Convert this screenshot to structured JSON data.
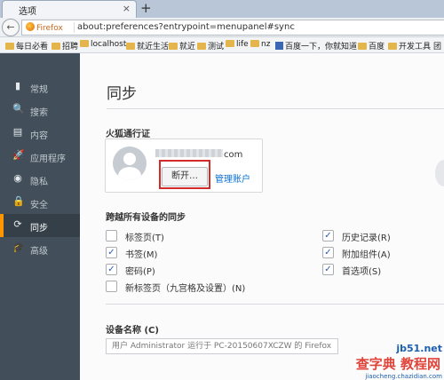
{
  "tab": {
    "title": "选项",
    "close": "×",
    "new_tab": "+"
  },
  "navbar": {
    "back": "←",
    "identity": "Firefox",
    "url": "about:preferences?entrypoint=menupanel#sync"
  },
  "bookmarks": [
    "每日必看",
    "招聘",
    "localhost",
    "就近生活",
    "就近",
    "测试",
    "life",
    "nz",
    "百度一下，你就知道",
    "百度",
    "开发工具",
    "团"
  ],
  "sidebar": {
    "items": [
      {
        "label": "常规",
        "icon": "▮"
      },
      {
        "label": "搜索",
        "icon": "🔍"
      },
      {
        "label": "内容",
        "icon": "▤"
      },
      {
        "label": "应用程序",
        "icon": "🚀"
      },
      {
        "label": "隐私",
        "icon": "◉"
      },
      {
        "label": "安全",
        "icon": "🔒"
      },
      {
        "label": "同步",
        "icon": "⟳"
      },
      {
        "label": "高级",
        "icon": "🎓"
      }
    ],
    "selected_index": 6,
    "accent": "#ff9500"
  },
  "main": {
    "title": "同步",
    "account_section": "火狐通行证",
    "email_suffix": "com",
    "disconnect": "断开…",
    "manage_account": "管理账户",
    "sync_section": "跨越所有设备的同步",
    "options_left": [
      {
        "label": "标签页(T)",
        "checked": false
      },
      {
        "label": "书签(M)",
        "checked": true
      },
      {
        "label": "密码(P)",
        "checked": true
      },
      {
        "label": "新标签页（九宫格及设置）(N)",
        "checked": false
      }
    ],
    "options_right": [
      {
        "label": "历史记录(R)",
        "checked": true
      },
      {
        "label": "附加组件(A)",
        "checked": true
      },
      {
        "label": "首选项(S)",
        "checked": true
      }
    ],
    "device_section": "设备名称 (C)",
    "device_name": "用户 Administrator 运行于 PC-20150607XCZW 的 Firefox"
  },
  "watermark": {
    "line1": "jb51.net",
    "line2": "查字典 教程网",
    "line3": "jiaocheng.chazidian.com"
  },
  "colors": {
    "link": "#0b71d5",
    "highlight": "#d32a2a",
    "sidebar_bg": "#424f5a"
  }
}
